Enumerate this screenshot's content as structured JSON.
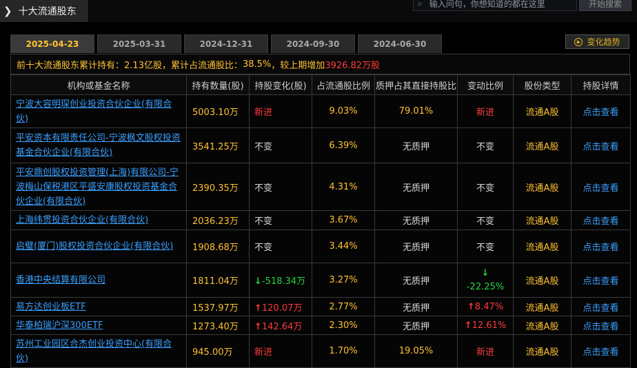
{
  "header": {
    "arrow": "❯",
    "title": "十大流通股东",
    "search_placeholder": "输入问句，你想知道的都在这里",
    "search_button": "开始搜索"
  },
  "tabs": [
    {
      "label": "2025-04-23",
      "active": true
    },
    {
      "label": "2025-03-31",
      "active": false
    },
    {
      "label": "2024-12-31",
      "active": false
    },
    {
      "label": "2024-09-30",
      "active": false
    },
    {
      "label": "2024-06-30",
      "active": false
    }
  ],
  "trend_button": "变化趋势",
  "summary": {
    "p1": "前十大流通股东累计持有：",
    "p2": "2.13亿股",
    "p3": "，累计占流通股比：",
    "p4": "38.5%",
    "p5": "，较上期增加",
    "p6": "3926.82万股"
  },
  "columns": [
    "机构或基金名称",
    "持有数量(股)",
    "持股变化(股)",
    "占流通股比例",
    "质押占其直接持股比",
    "变动比例",
    "股份类型",
    "持股详情"
  ],
  "rows": [
    {
      "name": "宁波大容明琛创业投资合伙企业(有限合伙)",
      "qty": "5003.10万",
      "change": "新进",
      "change_dir": "new",
      "ratio": "9.03%",
      "pledge": "79.01%",
      "pledge_color": "yellow",
      "var": "新进",
      "var_dir": "new",
      "type": "流通A股",
      "detail": "点击查看",
      "h": 48
    },
    {
      "name": "平安资本有限责任公司-宁波枫文股权投资基金合伙企业(有限合伙)",
      "qty": "3541.25万",
      "change": "不变",
      "change_dir": "same",
      "ratio": "6.39%",
      "pledge": "无质押",
      "pledge_color": "white",
      "var": "不变",
      "var_dir": "same",
      "type": "流通A股",
      "detail": "点击查看",
      "h": 51
    },
    {
      "name": "平安鼎创股权投资管理(上海)有限公司-宁波梅山保税港区平盛安康股权投资基金合伙企业(有限合伙)",
      "qty": "2390.35万",
      "change": "不变",
      "change_dir": "same",
      "ratio": "4.31%",
      "pledge": "无质押",
      "pledge_color": "white",
      "var": "不变",
      "var_dir": "same",
      "type": "流通A股",
      "detail": "点击查看",
      "h": 69
    },
    {
      "name": "上海纬贯投资合伙企业(有限合伙)",
      "qty": "2036.23万",
      "change": "不变",
      "change_dir": "same",
      "ratio": "3.67%",
      "pledge": "无质押",
      "pledge_color": "white",
      "var": "不变",
      "var_dir": "same",
      "type": "流通A股",
      "detail": "点击查看",
      "h": 28
    },
    {
      "name": "启璧(厦门)股权投资合伙企业(有限合伙)",
      "qty": "1908.68万",
      "change": "不变",
      "change_dir": "same",
      "ratio": "3.44%",
      "pledge": "无质押",
      "pledge_color": "white",
      "var": "不变",
      "var_dir": "same",
      "type": "流通A股",
      "detail": "点击查看",
      "h": 48
    },
    {
      "name": "香港中央结算有限公司",
      "qty": "1811.04万",
      "change": "-518.34万",
      "change_dir": "down",
      "ratio": "3.27%",
      "pledge": "无质押",
      "pledge_color": "white",
      "var": "-22.25%",
      "var_dir": "down",
      "type": "流通A股",
      "detail": "点击查看",
      "h": 50
    },
    {
      "name": "易方达创业板ETF",
      "qty": "1537.97万",
      "change": "120.07万",
      "change_dir": "up",
      "ratio": "2.77%",
      "pledge": "无质押",
      "pledge_color": "white",
      "var": "8.47%",
      "var_dir": "up",
      "type": "流通A股",
      "detail": "点击查看",
      "h": 27
    },
    {
      "name": "华泰柏瑞沪深300ETF",
      "qty": "1273.40万",
      "change": "142.64万",
      "change_dir": "up",
      "ratio": "2.30%",
      "pledge": "无质押",
      "pledge_color": "white",
      "var": "12.61%",
      "var_dir": "up",
      "type": "流通A股",
      "detail": "点击查看",
      "h": 27
    },
    {
      "name": "苏州工业园区合杰创业投资中心(有限合伙)",
      "qty": "945.00万",
      "change": "新进",
      "change_dir": "new",
      "ratio": "1.70%",
      "pledge": "19.05%",
      "pledge_color": "yellow",
      "var": "新进",
      "var_dir": "new",
      "type": "流通A股",
      "detail": "点击查看",
      "h": 48
    }
  ],
  "colors": {
    "accent": "#ffc233",
    "up": "#ff3b3b",
    "down": "#28d440",
    "link": "#3aa0ff"
  }
}
